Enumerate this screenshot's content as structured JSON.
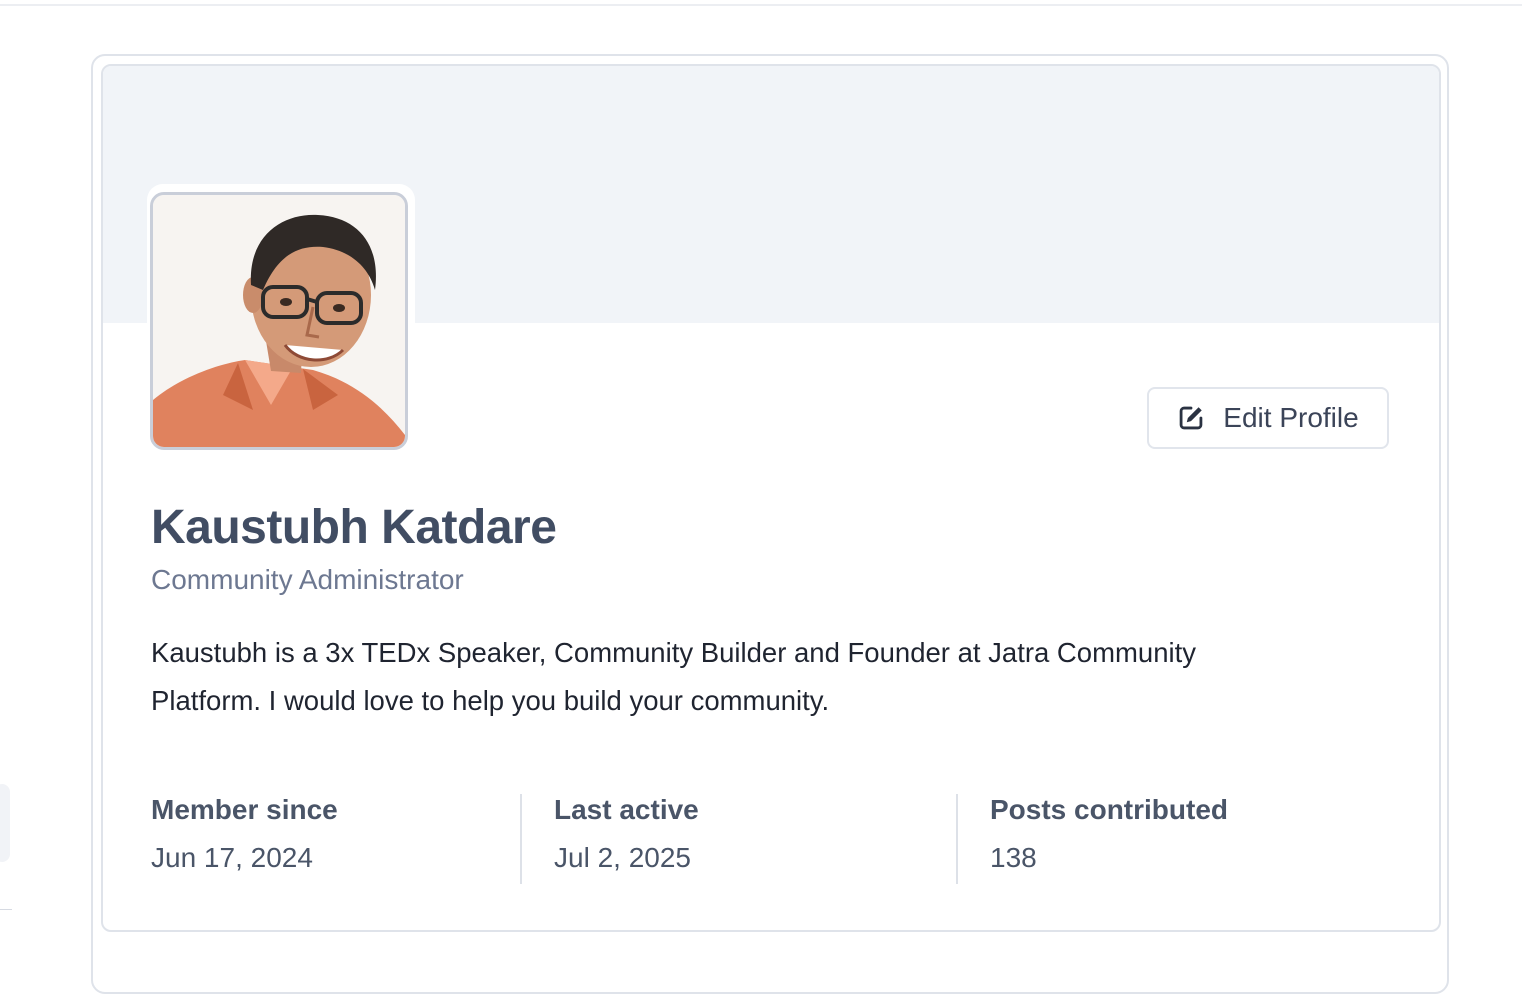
{
  "profile": {
    "avatar_alt": "Kaustubh Katdare profile photo",
    "edit_button_label": "Edit Profile",
    "name": "Kaustubh Katdare",
    "role": "Community Administrator",
    "bio": "Kaustubh is a 3x TEDx Speaker, Community Builder and Founder at Jatra Community Platform. I would love to help you build your community.",
    "stats": [
      {
        "label": "Member since",
        "value": "Jun 17, 2024"
      },
      {
        "label": "Last active",
        "value": "Jul 2, 2025"
      },
      {
        "label": "Posts contributed",
        "value": "138"
      }
    ]
  },
  "icons": {
    "edit": "pencil-square-icon"
  },
  "colors": {
    "banner": "#f1f4f8",
    "name": "#414d63",
    "role": "#6d7891",
    "border": "#dfe3ea",
    "shirt": "#e0825e"
  }
}
